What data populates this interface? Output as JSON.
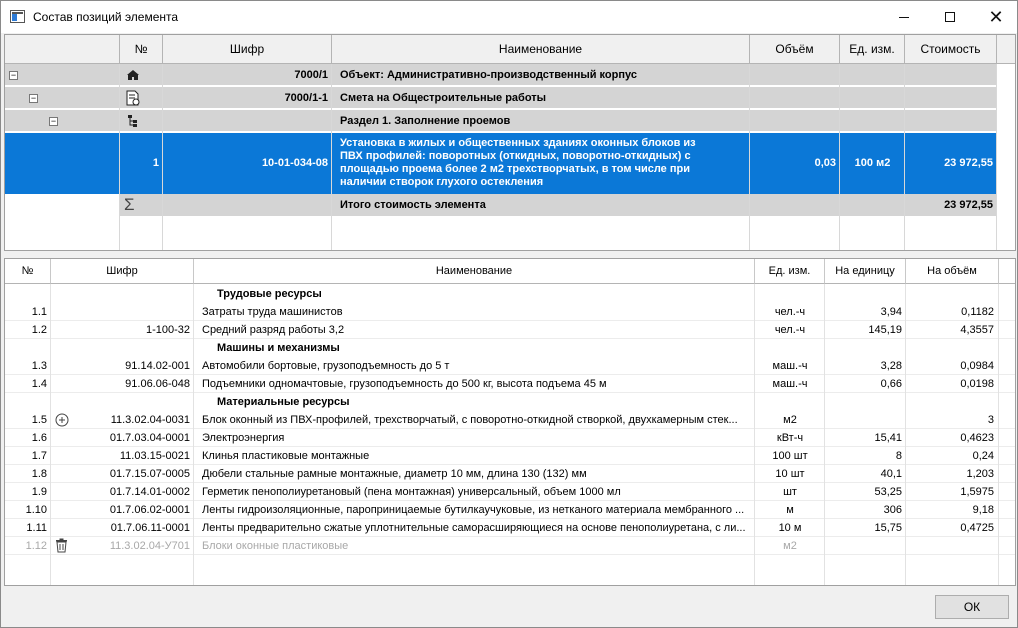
{
  "window": {
    "title": "Состав позиций элемента",
    "ok_label": "ОК"
  },
  "top_table": {
    "headers": [
      "№",
      "Шифр",
      "Наименование",
      "Объём",
      "Ед. изм.",
      "Стоимость"
    ],
    "rows": [
      {
        "code": "7000/1",
        "name": "Объект: Административно-производственный корпус",
        "icon": "building-icon"
      },
      {
        "code": "7000/1-1",
        "name": "Смета на Общестроительные работы",
        "icon": "estimate-document-icon"
      },
      {
        "code": "",
        "name": "Раздел 1. Заполнение проемов",
        "icon": "tree-structure-icon"
      }
    ],
    "selected": {
      "num": "1",
      "code": "10-01-034-08",
      "name_lines": [
        "Установка в жилых и общественных зданиях оконных блоков из",
        "ПВХ профилей: поворотных (откидных, поворотно-откидных) с",
        "площадью проема более 2 м2 трехстворчатых, в том числе при",
        "наличии створок глухого остекления"
      ],
      "volume": "0,03",
      "unit": "100 м2",
      "cost": "23 972,55"
    },
    "total": {
      "name": "Итого стоимость элемента",
      "cost": "23 972,55",
      "icon": "sum-icon"
    }
  },
  "bottom_table": {
    "headers": [
      "№",
      "Шифр",
      "Наименование",
      "Ед. изм.",
      "На единицу",
      "На объём"
    ],
    "rows": [
      {
        "type": "group",
        "name": "Трудовые ресурсы"
      },
      {
        "num": "1.1",
        "code": "",
        "name": "Затраты труда машинистов",
        "unit": "чел.-ч",
        "per_unit": "3,94",
        "per_vol": "0,1182"
      },
      {
        "num": "1.2",
        "code": "1-100-32",
        "name": "Средний разряд работы 3,2",
        "unit": "чел.-ч",
        "per_unit": "145,19",
        "per_vol": "4,3557"
      },
      {
        "type": "group",
        "name": "Машины и механизмы"
      },
      {
        "num": "1.3",
        "code": "91.14.02-001",
        "name": "Автомобили бортовые, грузоподъемность до 5 т",
        "unit": "маш.-ч",
        "per_unit": "3,28",
        "per_vol": "0,0984"
      },
      {
        "num": "1.4",
        "code": "91.06.06-048",
        "name": "Подъемники одномачтовые, грузоподъемность до 500 кг, высота подъема 45 м",
        "unit": "маш.-ч",
        "per_unit": "0,66",
        "per_vol": "0,0198"
      },
      {
        "type": "group",
        "name": "Материальные ресурсы"
      },
      {
        "num": "1.5",
        "code": "11.3.02.04-0031",
        "name": "Блок оконный из ПВХ-профилей, трехстворчатый, с поворотно-откидной створкой, двухкамерным стек...",
        "unit": "м2",
        "per_unit": "",
        "per_vol": "3",
        "icon": "add-circle-icon"
      },
      {
        "num": "1.6",
        "code": "01.7.03.04-0001",
        "name": "Электроэнергия",
        "unit": "кВт-ч",
        "per_unit": "15,41",
        "per_vol": "0,4623"
      },
      {
        "num": "1.7",
        "code": "11.03.15-0021",
        "name": "Клинья пластиковые монтажные",
        "unit": "100 шт",
        "per_unit": "8",
        "per_vol": "0,24"
      },
      {
        "num": "1.8",
        "code": "01.7.15.07-0005",
        "name": "Дюбели стальные рамные монтажные, диаметр 10 мм, длина 130 (132) мм",
        "unit": "10 шт",
        "per_unit": "40,1",
        "per_vol": "1,203"
      },
      {
        "num": "1.9",
        "code": "01.7.14.01-0002",
        "name": "Герметик пенополиуретановый (пена монтажная) универсальный, объем 1000 мл",
        "unit": "шт",
        "per_unit": "53,25",
        "per_vol": "1,5975"
      },
      {
        "num": "1.10",
        "code": "01.7.06.02-0001",
        "name": "Ленты гидроизоляционные, пароприницаемые бутилкаучуковые, из нетканого материала мембранного ...",
        "unit": "м",
        "per_unit": "306",
        "per_vol": "9,18"
      },
      {
        "num": "1.11",
        "code": "01.7.06.11-0001",
        "name": "Ленты предварительно сжатые уплотнительные саморасширяющиеся на основе пенополиуретана, с ли...",
        "unit": "10 м",
        "per_unit": "15,75",
        "per_vol": "0,4725"
      },
      {
        "num": "1.12",
        "code": "11.3.02.04-У701",
        "name": "Блоки оконные пластиковые",
        "unit": "м2",
        "per_unit": "",
        "per_vol": "",
        "icon": "trash-icon",
        "disabled": true
      }
    ]
  }
}
